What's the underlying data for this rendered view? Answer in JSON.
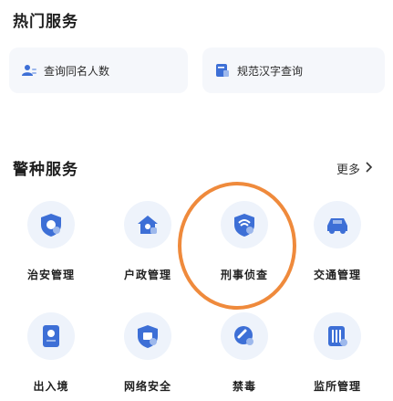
{
  "hot_services": {
    "title": "热门服务",
    "items": [
      {
        "label": "查询同名人数",
        "icon": "person-icon"
      },
      {
        "label": "规范汉字查询",
        "icon": "document-bookmark-icon"
      }
    ]
  },
  "police_services": {
    "title": "警种服务",
    "more_label": "更多",
    "items": [
      {
        "label": "治安管理",
        "icon": "shield-badge-icon"
      },
      {
        "label": "户政管理",
        "icon": "house-icon"
      },
      {
        "label": "刑事侦查",
        "icon": "shield-wave-icon"
      },
      {
        "label": "交通管理",
        "icon": "car-icon"
      },
      {
        "label": "出入境",
        "icon": "passport-icon"
      },
      {
        "label": "网络安全",
        "icon": "shield-check-icon"
      },
      {
        "label": "禁毒",
        "icon": "pill-icon"
      },
      {
        "label": "监所管理",
        "icon": "prison-bars-icon"
      }
    ]
  },
  "colors": {
    "icon_blue": "#3d6fd6",
    "icon_bg": "#eef3fb",
    "highlight": "#ef8a3c"
  }
}
